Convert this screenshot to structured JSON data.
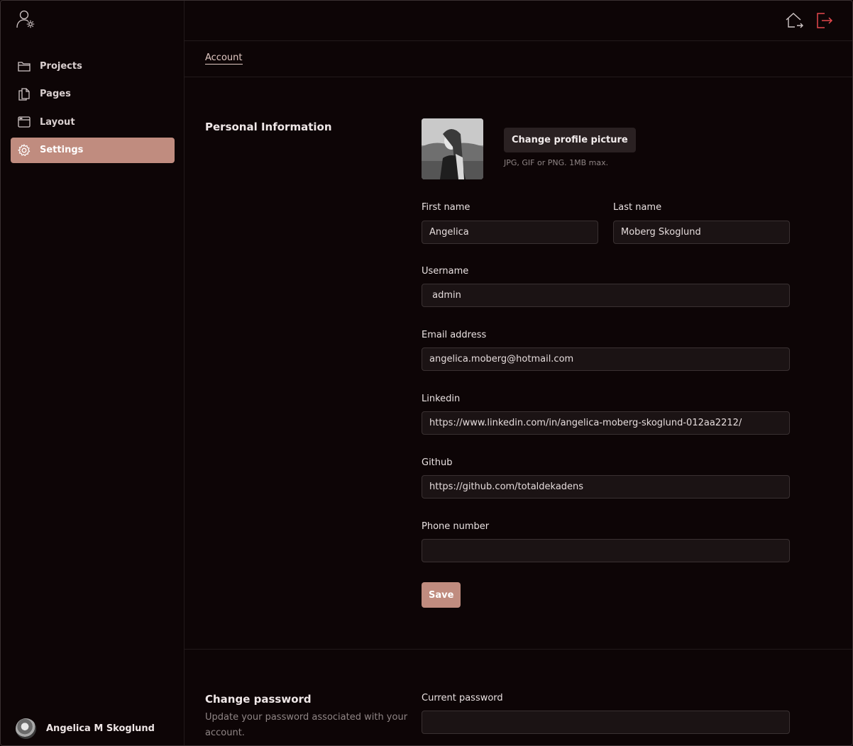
{
  "sidebar": {
    "logo_icon": "user-gear-icon",
    "items": [
      {
        "label": "Projects",
        "icon": "folder-icon",
        "active": false
      },
      {
        "label": "Pages",
        "icon": "pages-icon",
        "active": false
      },
      {
        "label": "Layout",
        "icon": "layout-icon",
        "active": false
      },
      {
        "label": "Settings",
        "icon": "gear-icon",
        "active": true
      }
    ],
    "user": {
      "name": "Angelica M Skoglund"
    }
  },
  "topbar": {
    "icons": [
      "home-exit-icon",
      "logout-icon"
    ],
    "logout_color": "#e5484d"
  },
  "tabs": [
    {
      "label": "Account"
    }
  ],
  "personal": {
    "title": "Personal Information",
    "change_picture_label": "Change profile picture",
    "picture_hint": "JPG, GIF or PNG. 1MB max.",
    "first_name_label": "First name",
    "first_name_value": "Angelica",
    "last_name_label": "Last name",
    "last_name_value": "Moberg Skoglund",
    "username_label": "Username",
    "username_value": " admin",
    "email_label": "Email address",
    "email_value": "angelica.moberg@hotmail.com",
    "linkedin_label": "Linkedin",
    "linkedin_value": "https://www.linkedin.com/in/angelica-moberg-skoglund-012aa2212/",
    "github_label": "Github",
    "github_value": "https://github.com/totaldekadens",
    "phone_label": "Phone number",
    "phone_value": "",
    "save_label": "Save"
  },
  "password": {
    "title": "Change password",
    "description": "Update your password associated with your account.",
    "current_label": "Current password",
    "current_value": ""
  },
  "colors": {
    "accent": "#c08c7f",
    "background": "#0d0506",
    "input_bg": "#1b1314"
  }
}
